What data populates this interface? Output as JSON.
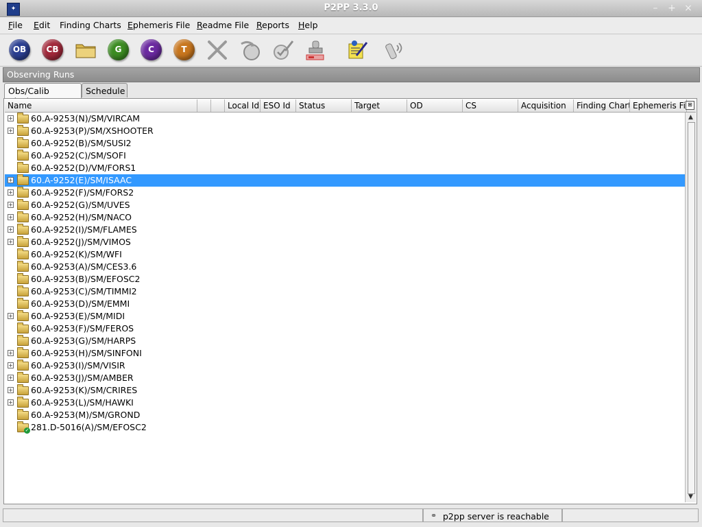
{
  "window": {
    "title": "P2PP 3.3.0",
    "controls": [
      "–",
      "+",
      "×"
    ]
  },
  "menus": [
    {
      "mn": "F",
      "rest": "ile"
    },
    {
      "mn": "E",
      "rest": "dit"
    },
    {
      "mn": "",
      "rest": "Finding Charts"
    },
    {
      "mn": "E",
      "rest": "phemeris File"
    },
    {
      "mn": "R",
      "rest": "eadme File"
    },
    {
      "mn": "R",
      "rest": "eports"
    },
    {
      "mn": "H",
      "rest": "elp"
    }
  ],
  "toolbar": {
    "buttons": [
      {
        "label": "OB",
        "color": "#2b3f91"
      },
      {
        "label": "CB",
        "color": "#a1283a"
      },
      {
        "label": "",
        "icon": "folder-icon"
      },
      {
        "label": "G",
        "color": "#3c8c22"
      },
      {
        "label": "C",
        "color": "#6b2aa0"
      },
      {
        "label": "T",
        "color": "#c8761e"
      },
      {
        "label": "",
        "icon": "delete-icon"
      },
      {
        "label": "",
        "icon": "check-in-icon"
      },
      {
        "label": "",
        "icon": "verify-icon"
      },
      {
        "label": "",
        "icon": "stamp-icon"
      },
      {
        "label": "",
        "icon": "readme-icon"
      },
      {
        "label": "",
        "icon": "connect-icon"
      }
    ]
  },
  "section_title": "Observing Runs",
  "tabs": [
    "Obs/Calib Blocks",
    "Schedule"
  ],
  "columns": [
    "Name",
    "",
    "",
    "Local Id",
    "ESO Id",
    "Status",
    "Target",
    "OD",
    "CS",
    "Acquisition",
    "Finding Chart",
    "Ephemeris File"
  ],
  "runs": [
    {
      "name": "60.A-9253(N)/SM/VIRCAM",
      "expandable": true,
      "selected": false,
      "status": ""
    },
    {
      "name": "60.A-9253(P)/SM/XSHOOTER",
      "expandable": true,
      "selected": false,
      "status": ""
    },
    {
      "name": "60.A-9252(B)/SM/SUSI2",
      "expandable": false,
      "selected": false,
      "status": ""
    },
    {
      "name": "60.A-9252(C)/SM/SOFI",
      "expandable": false,
      "selected": false,
      "status": ""
    },
    {
      "name": "60.A-9252(D)/VM/FORS1",
      "expandable": false,
      "selected": false,
      "status": ""
    },
    {
      "name": "60.A-9252(E)/SM/ISAAC",
      "expandable": true,
      "selected": true,
      "status": ""
    },
    {
      "name": "60.A-9252(F)/SM/FORS2",
      "expandable": true,
      "selected": false,
      "status": ""
    },
    {
      "name": "60.A-9252(G)/SM/UVES",
      "expandable": true,
      "selected": false,
      "status": ""
    },
    {
      "name": "60.A-9252(H)/SM/NACO",
      "expandable": true,
      "selected": false,
      "status": ""
    },
    {
      "name": "60.A-9252(I)/SM/FLAMES",
      "expandable": true,
      "selected": false,
      "status": ""
    },
    {
      "name": "60.A-9252(J)/SM/VIMOS",
      "expandable": true,
      "selected": false,
      "status": ""
    },
    {
      "name": "60.A-9252(K)/SM/WFI",
      "expandable": false,
      "selected": false,
      "status": ""
    },
    {
      "name": "60.A-9253(A)/SM/CES3.6",
      "expandable": false,
      "selected": false,
      "status": ""
    },
    {
      "name": "60.A-9253(B)/SM/EFOSC2",
      "expandable": false,
      "selected": false,
      "status": ""
    },
    {
      "name": "60.A-9253(C)/SM/TIMMI2",
      "expandable": false,
      "selected": false,
      "status": ""
    },
    {
      "name": "60.A-9253(D)/SM/EMMI",
      "expandable": false,
      "selected": false,
      "status": ""
    },
    {
      "name": "60.A-9253(E)/SM/MIDI",
      "expandable": true,
      "selected": false,
      "status": ""
    },
    {
      "name": "60.A-9253(F)/SM/FEROS",
      "expandable": false,
      "selected": false,
      "status": ""
    },
    {
      "name": "60.A-9253(G)/SM/HARPS",
      "expandable": false,
      "selected": false,
      "status": ""
    },
    {
      "name": "60.A-9253(H)/SM/SINFONI",
      "expandable": true,
      "selected": false,
      "status": ""
    },
    {
      "name": "60.A-9253(I)/SM/VISIR",
      "expandable": true,
      "selected": false,
      "status": ""
    },
    {
      "name": "60.A-9253(J)/SM/AMBER",
      "expandable": true,
      "selected": false,
      "status": ""
    },
    {
      "name": "60.A-9253(K)/SM/CRIRES",
      "expandable": true,
      "selected": false,
      "status": ""
    },
    {
      "name": "60.A-9253(L)/SM/HAWKI",
      "expandable": true,
      "selected": false,
      "status": ""
    },
    {
      "name": "60.A-9253(M)/SM/GROND",
      "expandable": false,
      "selected": false,
      "status": ""
    },
    {
      "name": "281.D-5016(A)/SM/EFOSC2",
      "expandable": false,
      "selected": false,
      "status": "verified"
    }
  ],
  "statusbar": {
    "message": "p2pp server is reachable",
    "icon": "link-icon"
  }
}
